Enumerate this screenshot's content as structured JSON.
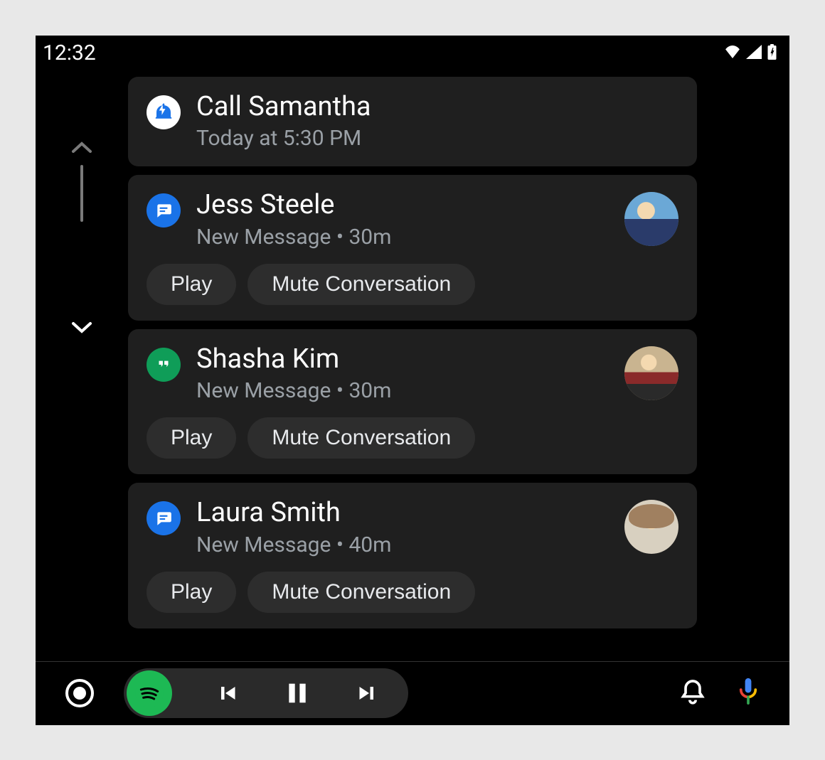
{
  "status": {
    "time": "12:32",
    "icons": {
      "wifi": "wifi-icon",
      "cell": "cell-icon",
      "battery": "battery-charging-icon"
    }
  },
  "cards": [
    {
      "app_icon": "reminder",
      "title": "Call Samantha",
      "subtitle": "Today at 5:30 PM",
      "avatar": null,
      "actions": []
    },
    {
      "app_icon": "messages",
      "title": "Jess Steele",
      "subtitle": "New Message • 30m",
      "avatar": "a",
      "actions": [
        "Play",
        "Mute Conversation"
      ]
    },
    {
      "app_icon": "hangouts",
      "title": "Shasha Kim",
      "subtitle": "New Message • 30m",
      "avatar": "b",
      "actions": [
        "Play",
        "Mute Conversation"
      ]
    },
    {
      "app_icon": "messages",
      "title": "Laura Smith",
      "subtitle": "New Message • 40m",
      "avatar": "c",
      "actions": [
        "Play",
        "Mute Conversation"
      ]
    }
  ],
  "bottom": {
    "media_app": "spotify",
    "controls": {
      "prev": "skip-previous",
      "pause": "pause",
      "next": "skip-next"
    },
    "notifications": "bell-icon",
    "assistant": "mic-icon"
  }
}
